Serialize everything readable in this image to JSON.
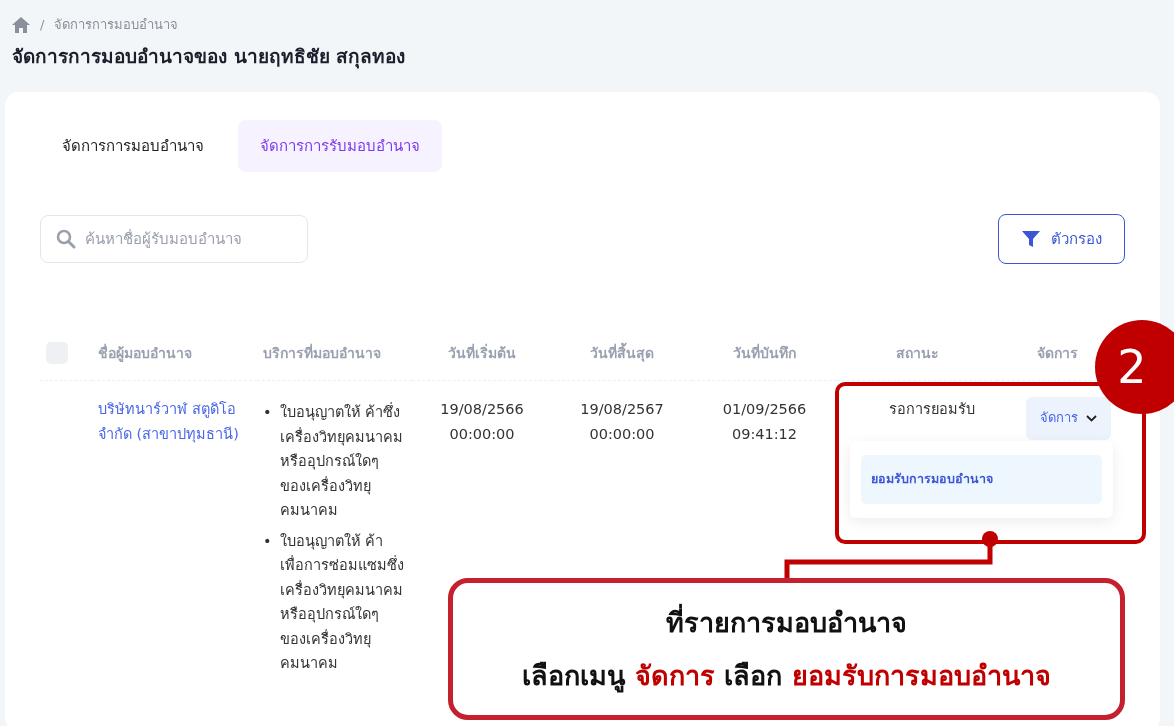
{
  "breadcrumb": {
    "separator": "/",
    "items": [
      "จัดการการมอบอำนาจ"
    ]
  },
  "page_title": "จัดการการมอบอำนาจของ นายฤทธิชัย สกุลทอง",
  "tabs": [
    {
      "label": "จัดการการมอบอำนาจ",
      "selected": false
    },
    {
      "label": "จัดการการรับมอบอำนาจ",
      "selected": true
    }
  ],
  "search": {
    "placeholder": "ค้นหาชื่อผู้รับมอบอำนาจ"
  },
  "filter_button": "ตัวกรอง",
  "table": {
    "select_all_checked": false,
    "columns": [
      "ชื่อผู้มอบอำนาจ",
      "บริการที่มอบอำนาจ",
      "วันที่เริ่มต้น",
      "วันที่สิ้นสุด",
      "วันที่บันทึก",
      "สถานะ",
      "จัดการ"
    ],
    "rows": [
      {
        "name": "บริษัทนาร์วาฬ สตูดิโอ จำกัด (สาขาปทุมธานี)",
        "services": [
          {
            "bullet": "•",
            "text": "ใบอนุญาตให้ ค้าซึ่งเครื่องวิทยุคมนาคม หรืออุปกรณ์ใดๆ ของเครื่องวิทยุคมนาคม"
          },
          {
            "bullet": "•",
            "text": "ใบอนุญาตให้ ค้าเพื่อการซ่อมแซมซึ่งเครื่องวิทยุคมนาคม หรืออุปกรณ์ใดๆ ของเครื่องวิทยุคมนาคม"
          }
        ],
        "start": [
          "19/08/2566",
          "00:00:00"
        ],
        "end": [
          "19/08/2567",
          "00:00:00"
        ],
        "saved": [
          "01/09/2566",
          "09:41:12"
        ],
        "status": "รอการยอมรับ",
        "action": "จัดการ",
        "menu_items": [
          "ยอมรับการมอบอำนาจ"
        ]
      }
    ]
  },
  "annotation": {
    "step": "2",
    "lines": [
      [
        {
          "text": "ที่รายการมอบอำนาจ",
          "highlight": false
        }
      ],
      [
        {
          "text": "เลือกเมนู ",
          "highlight": false
        },
        {
          "text": "จัดการ",
          "highlight": true
        },
        {
          "text": " เลือก ",
          "highlight": false
        },
        {
          "text": "ยอมรับการมอบอำนาจ",
          "highlight": true
        }
      ]
    ]
  }
}
